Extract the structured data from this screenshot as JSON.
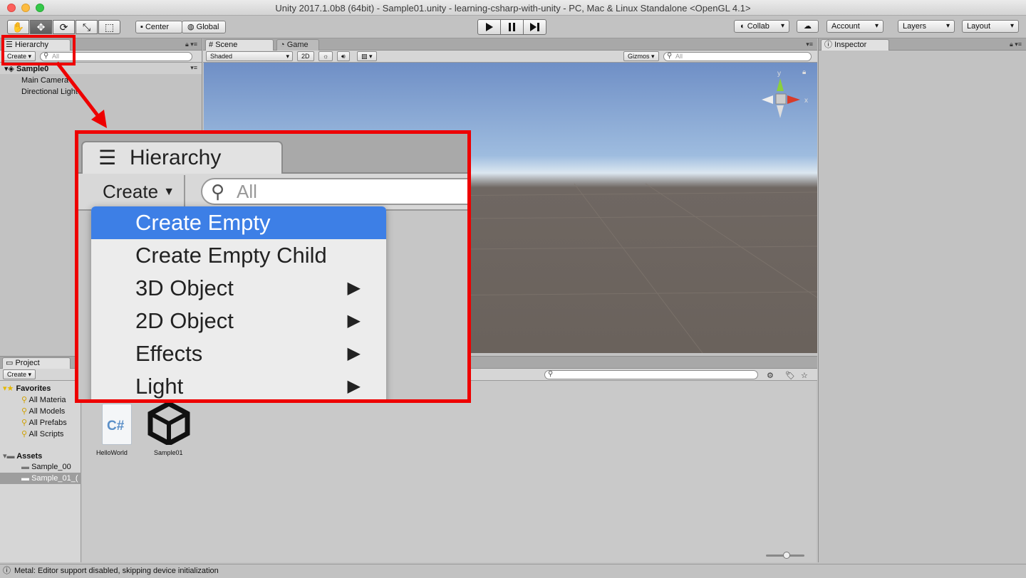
{
  "window": {
    "title": "Unity 2017.1.0b8 (64bit) - Sample01.unity - learning-csharp-with-unity - PC, Mac & Linux Standalone <OpenGL 4.1>"
  },
  "toolbar": {
    "tools": [
      "hand-icon",
      "move-icon",
      "rotate-icon",
      "scale-icon",
      "rect-icon"
    ],
    "pivot_label": "Center",
    "space_label": "Global",
    "collab_label": "Collab",
    "account_label": "Account",
    "layers_label": "Layers",
    "layout_label": "Layout"
  },
  "hierarchy": {
    "tab_label": "Hierarchy",
    "create_label": "Create",
    "search_placeholder": "All",
    "scene_name": "Sample0",
    "items": [
      "Main Camera",
      "Directional Light"
    ]
  },
  "scene": {
    "tab_label": "Scene",
    "game_tab_label": "Game",
    "shading_label": "Shaded",
    "mode_2d_label": "2D",
    "gizmos_label": "Gizmos",
    "search_placeholder": "All",
    "axis_y": "y",
    "axis_x": "x"
  },
  "inspector": {
    "tab_label": "Inspector"
  },
  "project": {
    "tab_label": "Project",
    "create_label": "Create",
    "favorites_label": "Favorites",
    "favorites": [
      "All Materia",
      "All Models",
      "All Prefabs",
      "All Scripts"
    ],
    "assets_label": "Assets",
    "folders": [
      "Sample_00",
      "Sample_01_("
    ],
    "files": [
      {
        "name": "HelloWorld",
        "icon": "csharp-script-icon",
        "glyph": "C#"
      },
      {
        "name": "Sample01",
        "icon": "unity-scene-icon"
      }
    ]
  },
  "status": {
    "message": "Metal: Editor support disabled, skipping device initialization"
  },
  "callout": {
    "tab_label": "Hierarchy",
    "create_label": "Create",
    "search_placeholder": "All",
    "menu_items": [
      {
        "label": "Create Empty",
        "selected": true,
        "submenu": false
      },
      {
        "label": "Create Empty Child",
        "selected": false,
        "submenu": false
      },
      {
        "label": "3D Object",
        "selected": false,
        "submenu": true
      },
      {
        "label": "2D Object",
        "selected": false,
        "submenu": true
      },
      {
        "label": "Effects",
        "selected": false,
        "submenu": true
      },
      {
        "label": "Light",
        "selected": false,
        "submenu": true
      }
    ],
    "highlight_color": "#ee0000",
    "selection_color": "#3d7fe6"
  }
}
